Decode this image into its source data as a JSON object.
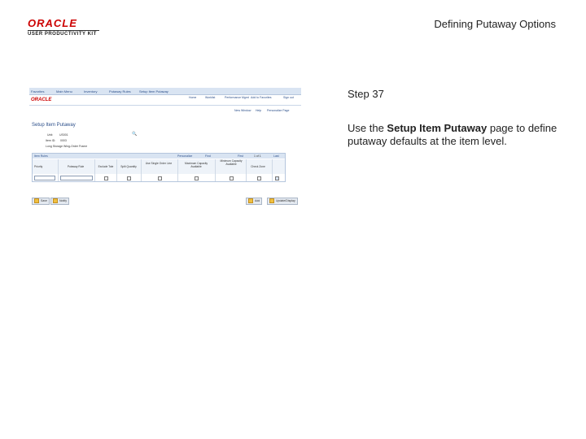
{
  "logo": {
    "brand": "ORACLE",
    "subtitle": "USER PRODUCTIVITY KIT"
  },
  "slide_title": "Defining Putaway Options",
  "step_label": "Step 37",
  "description": {
    "before": "Use the ",
    "bold": "Setup Item Putaway",
    "after": " page to define putaway defaults at the item level."
  },
  "screenshot": {
    "breadcrumbs": [
      "Favorites",
      "Main Menu",
      "Inventory",
      "Putaway Rules",
      "Setup Item Putaway"
    ],
    "brand": "ORACLE",
    "top_nav": [
      "Home",
      "Worklist",
      "Performance Mgmt",
      "Add to Favorites",
      "Sign out"
    ],
    "links": [
      "New Window",
      "Help",
      "Personalize Page"
    ],
    "page_title": "Setup Item Putaway",
    "fields": [
      {
        "label": "Unit:",
        "value": "US001"
      },
      {
        "label": "Item ID:",
        "value": "0003"
      },
      {
        "label": "Long Storage Wing-Order Frame"
      }
    ],
    "grid_title": "Item Rules",
    "grid_nav": [
      "Personalize",
      "Find",
      "First",
      "1 of 1",
      "Last"
    ],
    "columns": [
      "Priority",
      "Putaway Rule",
      "Exclude Tote",
      "Split Quantity",
      "Use Single Order Line",
      "Maximum Capacity Available",
      "Minimum Capacity Available",
      "Check Zone"
    ],
    "buttons": {
      "save": "Save",
      "notify": "Notify",
      "add": "Add",
      "update": "Update/Display"
    }
  }
}
